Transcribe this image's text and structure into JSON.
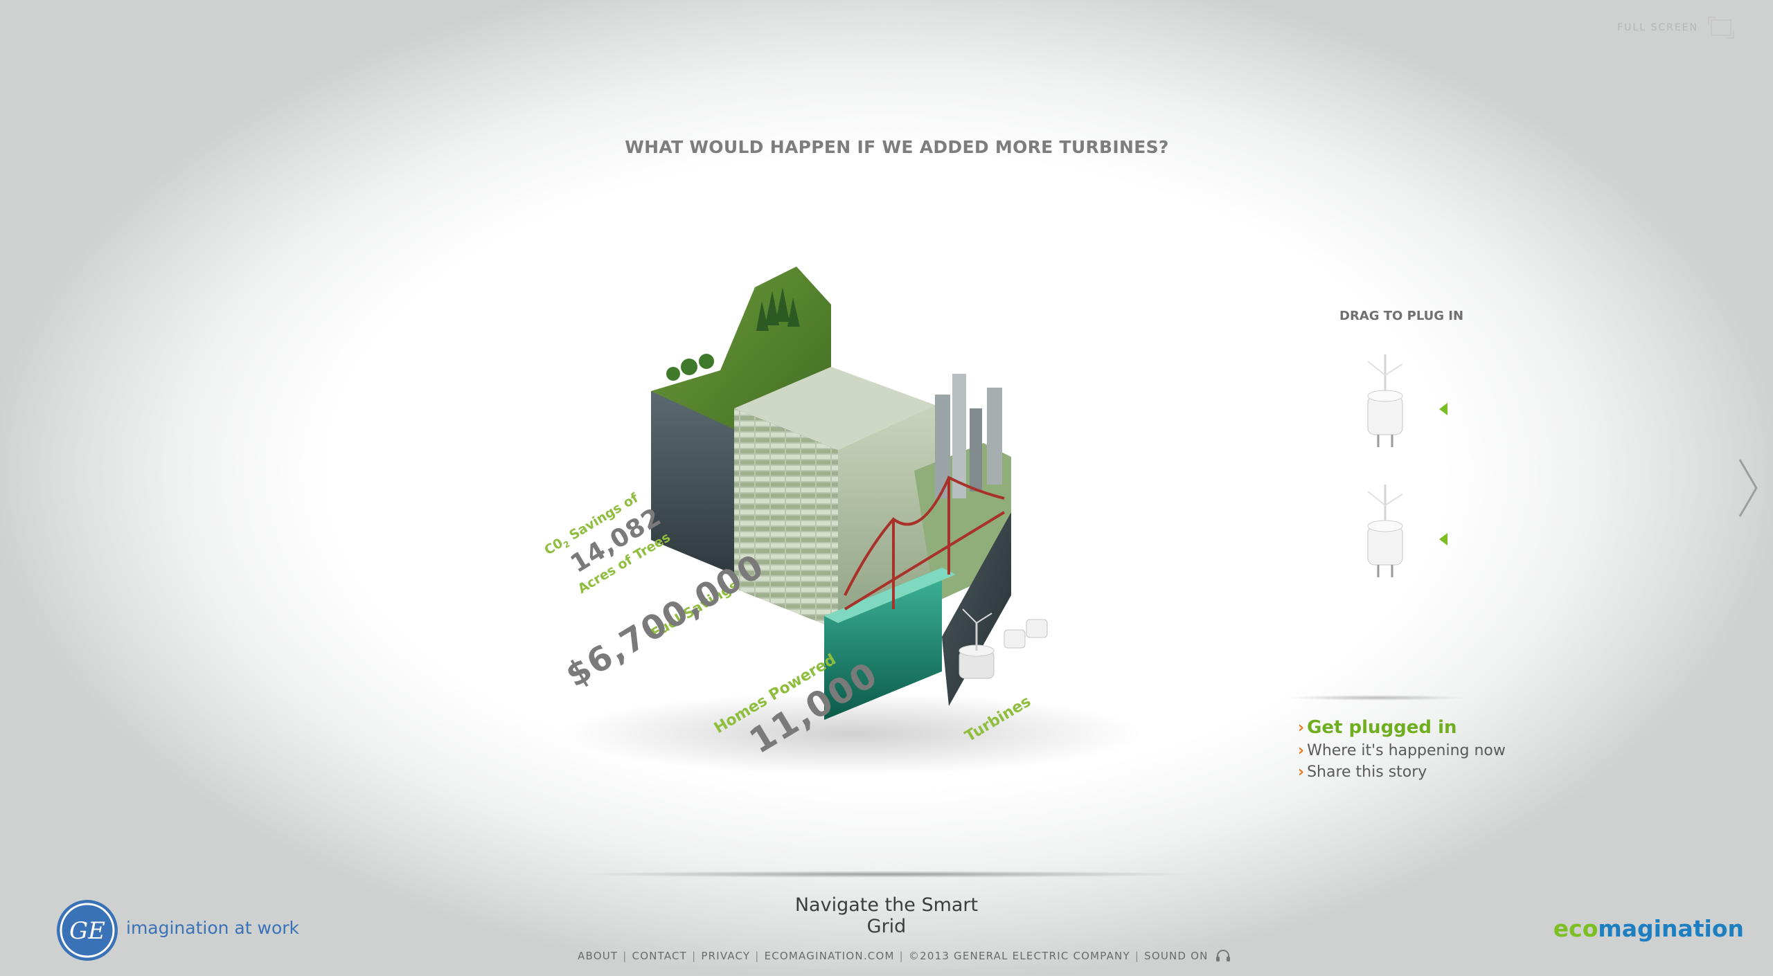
{
  "topbar": {
    "fullscreen_label": "FULL  SCREEN",
    "fullscreen_icon": "fullscreen-icon"
  },
  "headline": "WHAT WOULD HAPPEN IF WE ADDED MORE TURBINES?",
  "stats": {
    "co2_line1": "C0",
    "co2_sub": "2",
    "co2_line1b": " Savings of",
    "co2_value": "14,082",
    "co2_unit": "Acres of Trees",
    "fuel_label": "Fuel Savings",
    "fuel_value": "$6,700,000",
    "homes_label": "Homes Powered",
    "homes_value": "11,000",
    "turbines_label": "Turbines"
  },
  "drag_panel": {
    "title": "DRAG TO PLUG IN"
  },
  "side_links": [
    {
      "label": "Get plugged in"
    },
    {
      "label": "Where it's happening now"
    },
    {
      "label": "Share this story"
    }
  ],
  "navigate_label": "Navigate the Smart Grid",
  "footer": {
    "about": "ABOUT",
    "contact": "CONTACT",
    "privacy": "PRIVACY",
    "ecomagination": "ECOMAGINATION.COM",
    "copyright": "©2013  GENERAL ELECTRIC COMPANY",
    "sound": "SOUND ON",
    "sound_icon": "headphones-icon"
  },
  "brand": {
    "ge_tagline": "imagination at work",
    "eco_part1": "eco",
    "eco_part2": "magination",
    "colors": {
      "green": "#7cbf23",
      "blue": "#1d7fc2",
      "orange": "#e87a1e",
      "ge_blue": "#3a72b8"
    }
  }
}
